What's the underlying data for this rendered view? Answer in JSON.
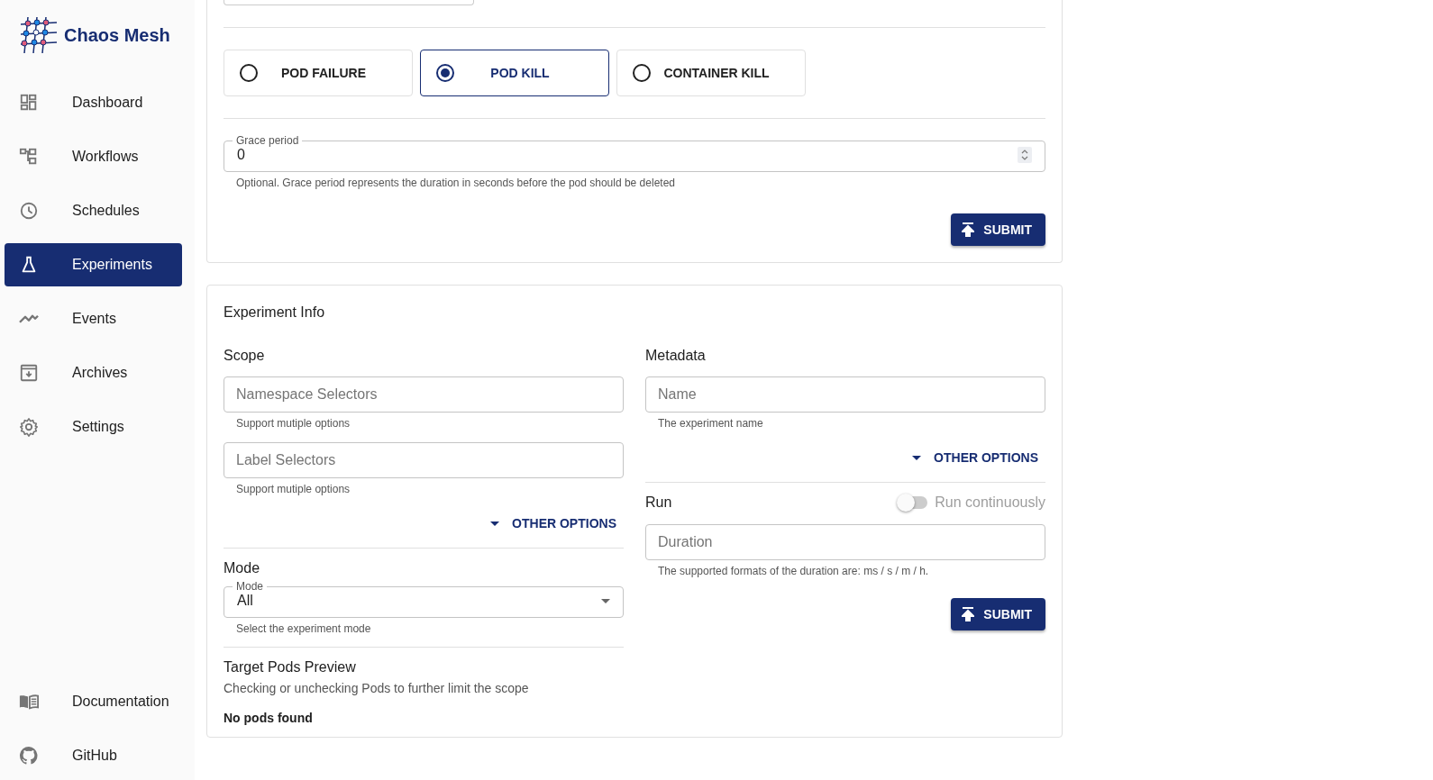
{
  "sidebar": {
    "brand": "Chaos Mesh",
    "items": [
      {
        "label": "Dashboard",
        "selected": false
      },
      {
        "label": "Workflows",
        "selected": false
      },
      {
        "label": "Schedules",
        "selected": false
      },
      {
        "label": "Experiments",
        "selected": true
      },
      {
        "label": "Events",
        "selected": false
      },
      {
        "label": "Archives",
        "selected": false
      },
      {
        "label": "Settings",
        "selected": false
      }
    ],
    "footer_items": [
      {
        "label": "Documentation"
      },
      {
        "label": "GitHub"
      }
    ]
  },
  "action_card": {
    "options": [
      {
        "label": "POD FAILURE",
        "selected": false
      },
      {
        "label": "POD KILL",
        "selected": true
      },
      {
        "label": "CONTAINER KILL",
        "selected": false
      }
    ],
    "grace_period": {
      "label": "Grace period",
      "value": "0",
      "helper": "Optional. Grace period represents the duration in seconds before the pod should be deleted"
    },
    "submit": "SUBMIT"
  },
  "info_card": {
    "title": "Experiment Info",
    "scope": {
      "heading": "Scope",
      "fields": [
        {
          "placeholder": "Namespace Selectors",
          "helper": "Support mutiple options"
        },
        {
          "placeholder": "Label Selectors",
          "helper": "Support mutiple options"
        }
      ],
      "other_options": "OTHER OPTIONS"
    },
    "mode": {
      "heading": "Mode",
      "label": "Mode",
      "value": "All",
      "helper": "Select the experiment mode"
    },
    "target_pods": {
      "title": "Target Pods Preview",
      "description": "Checking or unchecking Pods to further limit the scope",
      "empty": "No pods found"
    },
    "metadata": {
      "heading": "Metadata",
      "fields": [
        {
          "placeholder": "Name",
          "helper": "The experiment name"
        }
      ],
      "other_options": "OTHER OPTIONS"
    },
    "run": {
      "heading": "Run",
      "switch": {
        "label": "Run continuously",
        "on": false
      },
      "duration": {
        "placeholder": "Duration",
        "helper": "The supported formats of the duration are: ms / s / m / h."
      }
    },
    "submit": "SUBMIT"
  }
}
